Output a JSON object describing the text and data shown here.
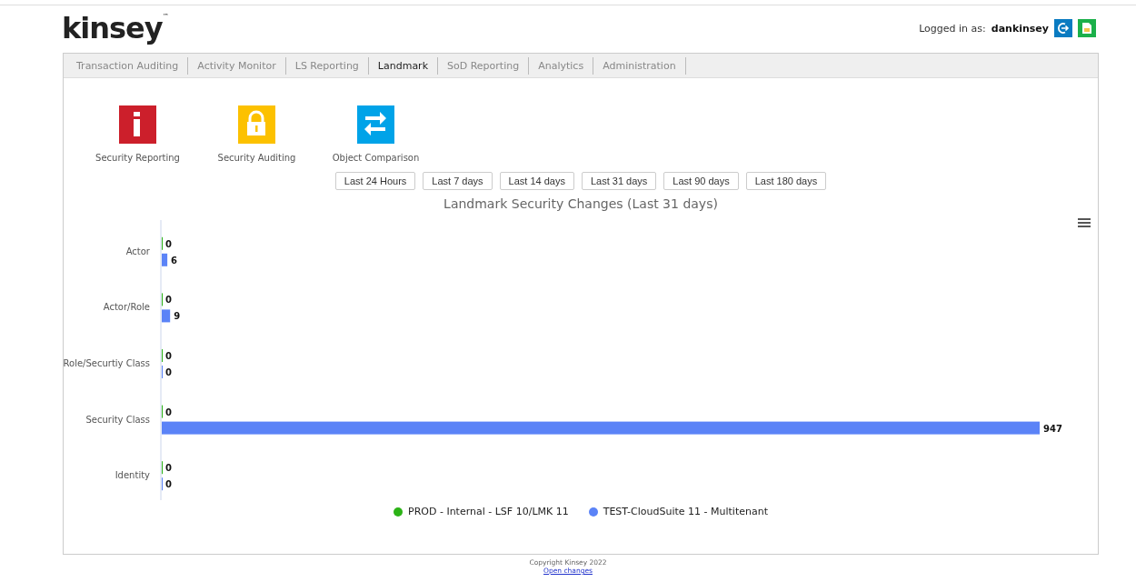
{
  "header": {
    "logo": "kinsey",
    "logo_mark": "™",
    "login_label": "Logged in as:",
    "username": "dankinsey"
  },
  "tabs": [
    {
      "label": "Transaction Auditing",
      "selected": false
    },
    {
      "label": "Activity Monitor",
      "selected": false
    },
    {
      "label": "LS Reporting",
      "selected": false
    },
    {
      "label": "Landmark",
      "selected": true
    },
    {
      "label": "SoD Reporting",
      "selected": false
    },
    {
      "label": "Analytics",
      "selected": false
    },
    {
      "label": "Administration",
      "selected": false
    }
  ],
  "shortcuts": [
    {
      "label": "Security Reporting",
      "kind": "info",
      "color": "#cc1f2b"
    },
    {
      "label": "Security Auditing",
      "kind": "lock",
      "color": "#fcc100"
    },
    {
      "label": "Object Comparison",
      "kind": "swap",
      "color": "#00a3e8"
    }
  ],
  "range_buttons": [
    "Last 24 Hours",
    "Last 7 days",
    "Last 14 days",
    "Last 31 days",
    "Last 90 days",
    "Last 180 days"
  ],
  "chart": {
    "chart_data": {
      "type": "bar",
      "orientation": "horizontal",
      "title": "Landmark Security Changes (Last 31 days)",
      "categories": [
        "Actor",
        "Actor/Role",
        "Role/Securtiy Class",
        "Security Class",
        "Identity"
      ],
      "data_labels": true,
      "series": [
        {
          "name": "PROD - Internal - LSF 10/LMK 11",
          "color": "#2cb317",
          "values": [
            0,
            0,
            0,
            0,
            0
          ]
        },
        {
          "name": "TEST-CloudSuite 11 - Multitenant",
          "color": "#5b83f7",
          "values": [
            6,
            9,
            0,
            947,
            0
          ]
        }
      ]
    }
  },
  "footer": {
    "copyright": "Copyright Kinsey 2022",
    "link": "Open changes"
  }
}
